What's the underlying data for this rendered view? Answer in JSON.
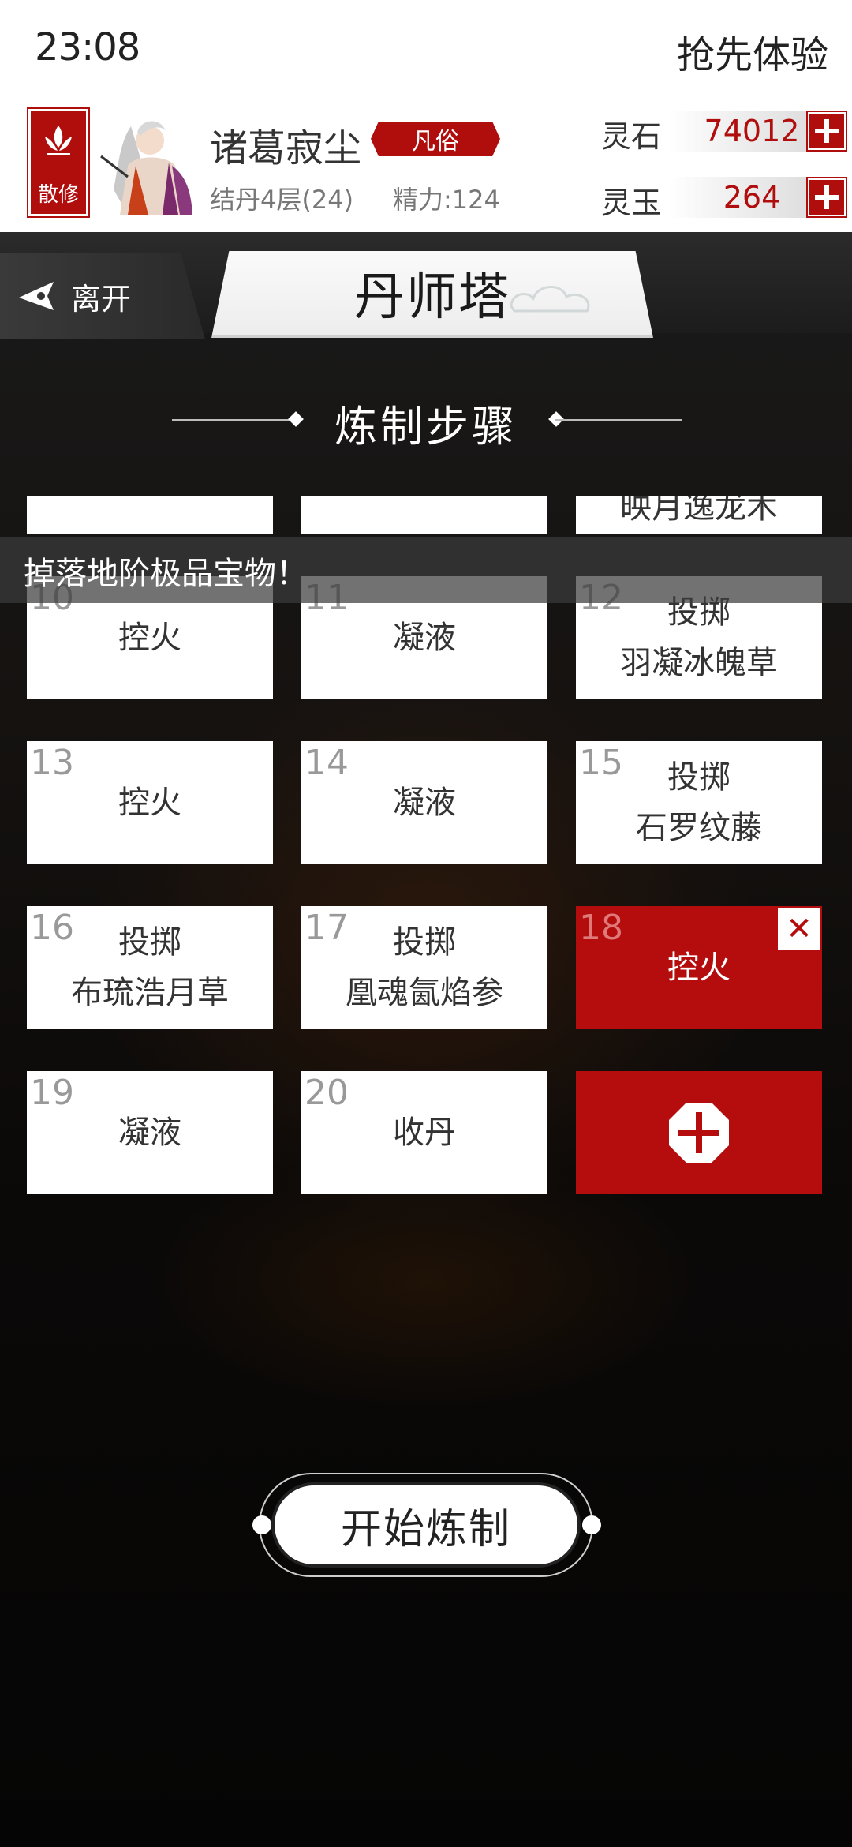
{
  "status": {
    "time": "23:08",
    "action_label": "抢先体验"
  },
  "player": {
    "sect_badge": "散修",
    "name": "诸葛寂尘",
    "rank": "凡俗",
    "realm": "结丹4层(24)",
    "energy": "精力:124"
  },
  "currencies": [
    {
      "label": "灵石",
      "value": "74012"
    },
    {
      "label": "灵玉",
      "value": "264"
    }
  ],
  "nav": {
    "leave_label": "离开",
    "title": "丹师塔"
  },
  "section": {
    "title": "炼制步骤"
  },
  "partial_row": [
    "",
    "",
    "映月逸龙木"
  ],
  "marquee": {
    "text": "掉落地阶极品宝物！"
  },
  "steps": [
    {
      "num": "10",
      "line1": "控火",
      "line2": ""
    },
    {
      "num": "11",
      "line1": "凝液",
      "line2": ""
    },
    {
      "num": "12",
      "line1": "投掷",
      "line2": "羽凝冰魄草"
    },
    {
      "num": "13",
      "line1": "控火",
      "line2": ""
    },
    {
      "num": "14",
      "line1": "凝液",
      "line2": ""
    },
    {
      "num": "15",
      "line1": "投掷",
      "line2": "石罗纹藤"
    },
    {
      "num": "16",
      "line1": "投掷",
      "line2": "布琉浩月草"
    },
    {
      "num": "17",
      "line1": "投掷",
      "line2": "凰魂氤焰参"
    },
    {
      "num": "18",
      "line1": "控火",
      "line2": "",
      "active": true
    },
    {
      "num": "19",
      "line1": "凝液",
      "line2": ""
    },
    {
      "num": "20",
      "line1": "收丹",
      "line2": ""
    }
  ],
  "remove_symbol": "✕",
  "start_button": {
    "label": "开始炼制"
  },
  "colors": {
    "accent_red": "#b50d0d",
    "background": "#000000"
  }
}
